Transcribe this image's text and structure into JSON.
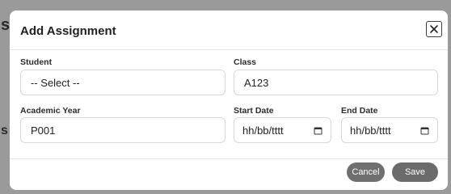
{
  "backdrop": {
    "letter_top": "s",
    "letter_bottom": "s"
  },
  "modal": {
    "title": "Add Assignment",
    "close_icon": "close-icon"
  },
  "form": {
    "student": {
      "label": "Student",
      "value": "-- Select --"
    },
    "class": {
      "label": "Class",
      "value": "A123"
    },
    "academic_year": {
      "label": "Academic Year",
      "value": "P001"
    },
    "start_date": {
      "label": "Start Date",
      "value": "hh/bb/tttt",
      "icon": "calendar-icon"
    },
    "end_date": {
      "label": "End Date",
      "value": "hh/bb/tttt",
      "icon": "calendar-icon"
    }
  },
  "footer": {
    "cancel_label": "Cancel",
    "save_label": "Save"
  }
}
